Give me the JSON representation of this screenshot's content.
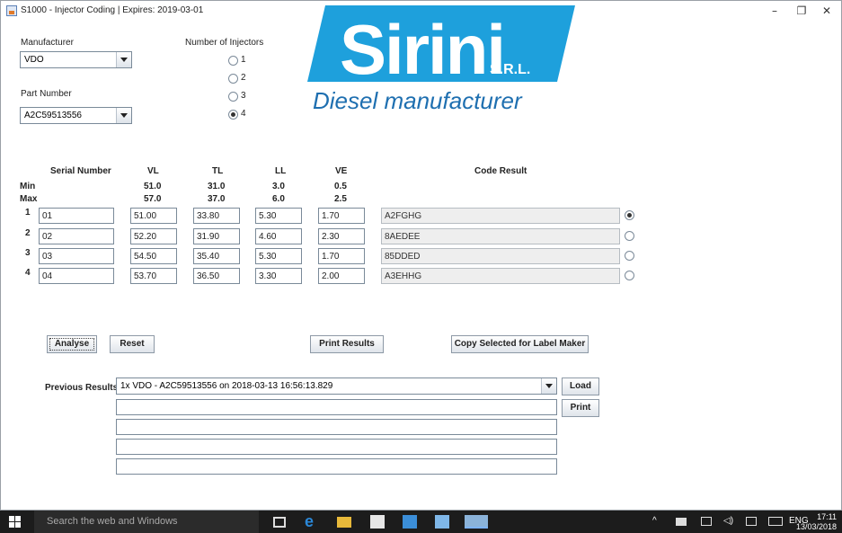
{
  "window": {
    "title": "S1000 - Injector Coding | Expires: 2019-03-01",
    "minimize": "–",
    "maximize": "❐",
    "close": "✕"
  },
  "manufacturer": {
    "label": "Manufacturer",
    "value": "VDO"
  },
  "part_number": {
    "label": "Part Number",
    "value": "A2C59513556"
  },
  "injectors": {
    "label": "Number of Injectors",
    "options": [
      "1",
      "2",
      "3",
      "4"
    ],
    "selected": "4"
  },
  "logo": {
    "brand": "Sirini",
    "suffix": "S.R.L.",
    "tagline": "Diesel manufacturer",
    "color": "#1ea0dc"
  },
  "table": {
    "headers": {
      "serial": "Serial Number",
      "vl": "VL",
      "tl": "TL",
      "ll": "LL",
      "ve": "VE",
      "code": "Code Result"
    },
    "min": {
      "label": "Min",
      "vl": "51.0",
      "tl": "31.0",
      "ll": "3.0",
      "ve": "0.5"
    },
    "max": {
      "label": "Max",
      "vl": "57.0",
      "tl": "37.0",
      "ll": "6.0",
      "ve": "2.5"
    },
    "rows": [
      {
        "num": "1",
        "serial": "01",
        "vl": "51.00",
        "tl": "33.80",
        "ll": "5.30",
        "ve": "1.70",
        "code": "A2FGHG",
        "selected": true
      },
      {
        "num": "2",
        "serial": "02",
        "vl": "52.20",
        "tl": "31.90",
        "ll": "4.60",
        "ve": "2.30",
        "code": "8AEDEE",
        "selected": false
      },
      {
        "num": "3",
        "serial": "03",
        "vl": "54.50",
        "tl": "35.40",
        "ll": "5.30",
        "ve": "1.70",
        "code": "85DDED",
        "selected": false
      },
      {
        "num": "4",
        "serial": "04",
        "vl": "53.70",
        "tl": "36.50",
        "ll": "3.30",
        "ve": "2.00",
        "code": "A3EHHG",
        "selected": false
      }
    ]
  },
  "buttons": {
    "analyse": "Analyse",
    "reset": "Reset",
    "print_results": "Print Results",
    "copy_label": "Copy Selected for Label Maker",
    "load": "Load",
    "print": "Print"
  },
  "previous": {
    "label": "Previous Results",
    "value": "1x VDO  -  A2C59513556  on  2018-03-13 16:56:13.829",
    "lines": [
      "",
      "",
      "",
      ""
    ]
  },
  "taskbar": {
    "search_placeholder": "Search the web and Windows",
    "lang": "ENG",
    "time": "17:11",
    "date": "13/03/2018"
  }
}
